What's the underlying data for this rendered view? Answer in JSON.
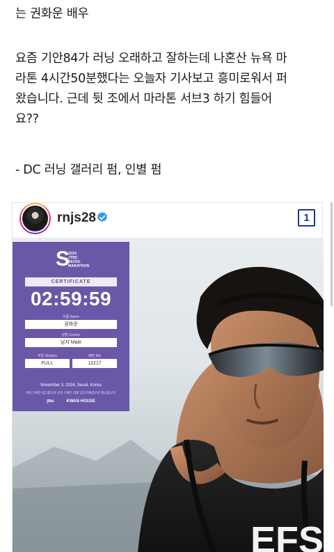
{
  "post": {
    "line1": "는 권화운 배우",
    "paragraph_lines": [
      "요즘 기안84가 러닝 오래하고 잘하는데 나혼산 뉴욕 마",
      "라톤 4시간50분했다는 오늘자 기사보고 흥미로워서 퍼",
      "왔습니다. 근데 뒷 조에서 마라톤 서브3 하기 힘들어",
      "요??"
    ],
    "credit": "- DC 러닝 갤러리 펌, 인별 펌"
  },
  "instagram": {
    "username": "rnjs28",
    "count": "1",
    "verified_icon": "verified-badge-icon",
    "accent_color": "#3897f0"
  },
  "certificate": {
    "logo_letter": "S",
    "logo_lines": [
      "2024",
      "JTBC",
      "SEOUL",
      "MARATHON"
    ],
    "title": "CERTIFICATE",
    "time": "02:59:59",
    "name_label": "이름 Name",
    "name": "권화운",
    "gender_label": "성별 Gender",
    "gender": "남자 Male",
    "division_label": "부문 Division",
    "division": "FULL",
    "bib_label": "배번 Bib",
    "bib": "12217",
    "date": "November 3, 2024, Seoul, Korea",
    "note": "위의 기록은 팀그룹으로 공인 기록은 대회 공인기록증으로 제공됩니다.",
    "sponsors": [
      "jtbc",
      "KWAN HOUSE"
    ],
    "bg_color": "#6b57a8"
  },
  "photo": {
    "shirt_text": "EFS"
  }
}
